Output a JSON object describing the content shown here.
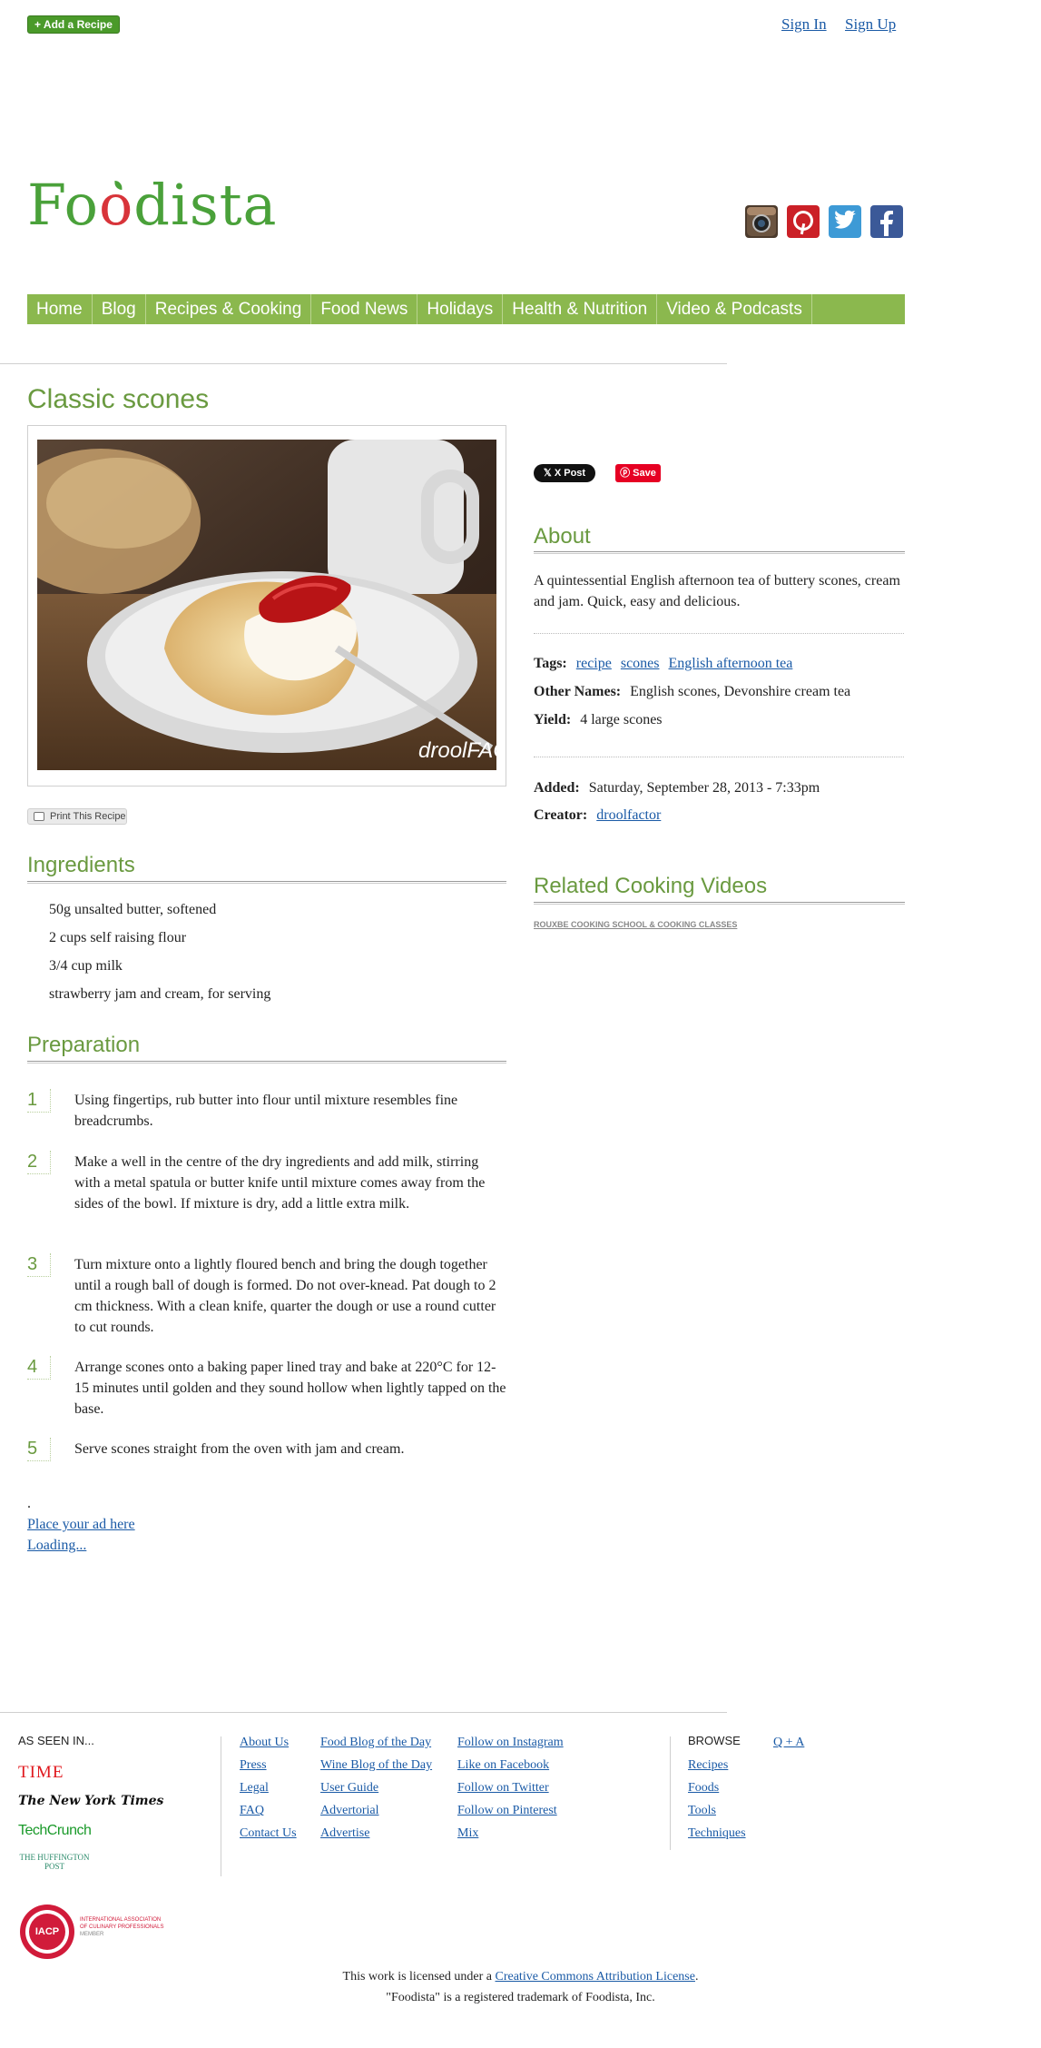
{
  "topbar": {
    "add_recipe_label": "+ Add a Recipe",
    "sign_in": "Sign In",
    "sign_up": "Sign Up"
  },
  "logo": {
    "text_before": "Fo",
    "text_o": "o",
    "text_after": "dista"
  },
  "social": [
    {
      "name": "instagram-icon",
      "color": "#5a4a3a"
    },
    {
      "name": "pinterest-icon",
      "color": "#cb2027"
    },
    {
      "name": "twitter-icon",
      "color": "#3d9ad6"
    },
    {
      "name": "facebook-icon",
      "color": "#3b5998"
    }
  ],
  "nav": [
    "Home",
    "Blog",
    "Recipes & Cooking",
    "Food News",
    "Holidays",
    "Health & Nutrition",
    "Video & Podcasts"
  ],
  "recipe": {
    "title": "Classic scones",
    "photo_watermark": "droolFACT",
    "print_label": "Print This Recipe",
    "ingredients_heading": "Ingredients",
    "ingredients": [
      "50g unsalted butter, softened",
      "2 cups self raising flour",
      "3/4 cup milk",
      "strawberry jam and cream, for serving"
    ],
    "preparation_heading": "Preparation",
    "steps": [
      {
        "num": "1",
        "text": "Using fingertips, rub butter into flour until mixture resembles fine breadcrumbs."
      },
      {
        "num": "2",
        "text": "Make a well in the centre of the dry ingredients and add milk, stirring with a metal spatula or butter knife until mixture comes away from the sides of the bowl. If mixture is dry, add a little extra milk."
      },
      {
        "num": "3",
        "text": "Turn mixture onto a lightly floured bench and bring the dough together until a rough ball of dough is formed. Do not over-knead. Pat dough to 2 cm thickness. With a clean knife, quarter the dough or use a round cutter to cut rounds."
      },
      {
        "num": "4",
        "text": "Arrange scones onto a baking paper lined tray and bake at 220°C for 12-15 minutes until golden and they sound hollow when lightly tapped on the base."
      },
      {
        "num": "5",
        "text": "Serve scones straight from the oven with jam and cream."
      }
    ]
  },
  "ad": {
    "dot": ".",
    "place_ad": "Place your ad here",
    "loading": "Loading..."
  },
  "sidebar": {
    "x_post": "X Post",
    "pin_save": "Save",
    "about_heading": "About",
    "about_text": "A quintessential English afternoon tea of buttery scones, cream and jam. Quick, easy and delicious.",
    "tags_label": "Tags:",
    "tags": [
      "recipe",
      "scones",
      "English afternoon tea"
    ],
    "other_names_label": "Other Names:",
    "other_names": "English scones, Devonshire cream tea",
    "yield_label": "Yield:",
    "yield": "4 large scones",
    "added_label": "Added:",
    "added": "Saturday, September 28, 2013 - 7:33pm",
    "creator_label": "Creator:",
    "creator": "droolfactor",
    "related_heading": "Related Cooking Videos",
    "rouxbe": "ROUXBE COOKING SCHOOL & COOKING CLASSES"
  },
  "footer": {
    "seen_in": "AS SEEN IN...",
    "press": [
      "TIME",
      "The New York Times",
      "TechCrunch",
      "THE HUFFINGTON POST"
    ],
    "col1": [
      "About Us",
      "Press",
      "Legal",
      "FAQ",
      "Contact Us"
    ],
    "col2": [
      "Food Blog of the Day",
      "Wine Blog of the Day",
      "User Guide",
      "Advertorial",
      "Advertise"
    ],
    "col3": [
      "Follow on Instagram",
      "Like on Facebook",
      "Follow on Twitter",
      "Follow on Pinterest",
      "Mix"
    ],
    "browse_label": "BROWSE",
    "qa": "Q + A",
    "browse": [
      "Recipes",
      "Foods",
      "Tools",
      "Techniques"
    ],
    "iacp_badge": "IACP",
    "iacp_text": [
      "INTERNATIONAL ASSOCIATION",
      "OF CULINARY PROFESSIONALS",
      "MEMBER"
    ],
    "license_prefix": "This work is licensed under a",
    "license_link": "Creative Commons Attribution License",
    "license_suffix": ".",
    "trademark": "\"Foodista\" is a registered trademark of Foodista, Inc."
  }
}
